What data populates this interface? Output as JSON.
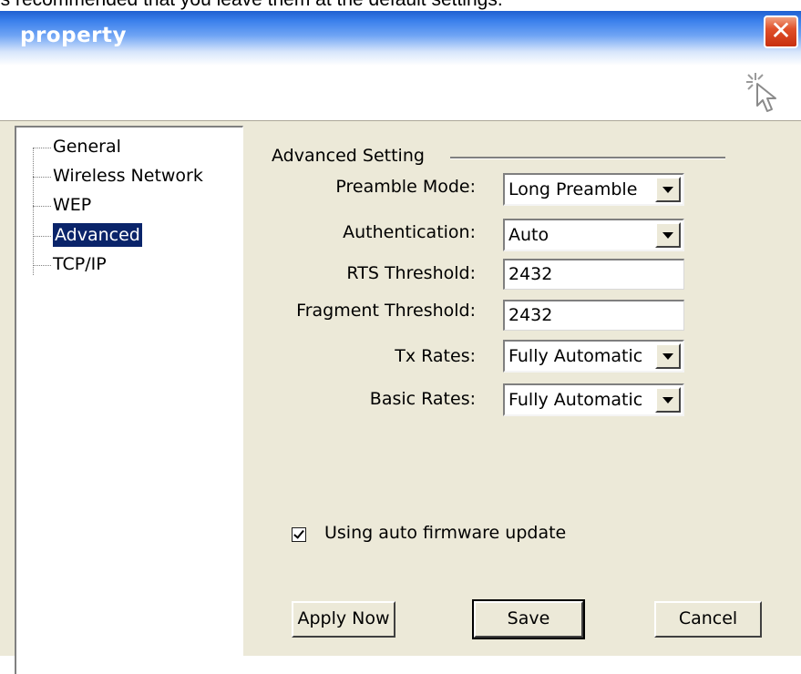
{
  "page_caption": "is recommended that you leave them at the default settings.",
  "window": {
    "title": "property",
    "close_symbol": "✕"
  },
  "tree": {
    "items": [
      {
        "label": "General",
        "selected": false
      },
      {
        "label": "Wireless Network",
        "selected": false
      },
      {
        "label": "WEP",
        "selected": false
      },
      {
        "label": "Advanced",
        "selected": true
      },
      {
        "label": "TCP/IP",
        "selected": false
      }
    ]
  },
  "advanced": {
    "group_label": "Advanced Setting",
    "preamble_mode": {
      "label": "Preamble Mode:",
      "value": "Long Preamble"
    },
    "authentication": {
      "label": "Authentication:",
      "value": "Auto"
    },
    "rts_threshold": {
      "label": "RTS Threshold:",
      "value": "2432"
    },
    "fragment_threshold": {
      "label": "Fragment Threshold:",
      "value": "2432"
    },
    "tx_rates": {
      "label": "Tx Rates:",
      "value": "Fully Automatic"
    },
    "basic_rates": {
      "label": "Basic Rates:",
      "value": "Fully Automatic"
    },
    "auto_firmware": {
      "label": "Using auto firmware update",
      "checked": true
    }
  },
  "buttons": {
    "apply_now": "Apply Now",
    "save": "Save",
    "cancel": "Cancel"
  },
  "colors": {
    "selection": "#0a246a",
    "dialog_face": "#ece9d8",
    "close_button": "#e0502a"
  }
}
